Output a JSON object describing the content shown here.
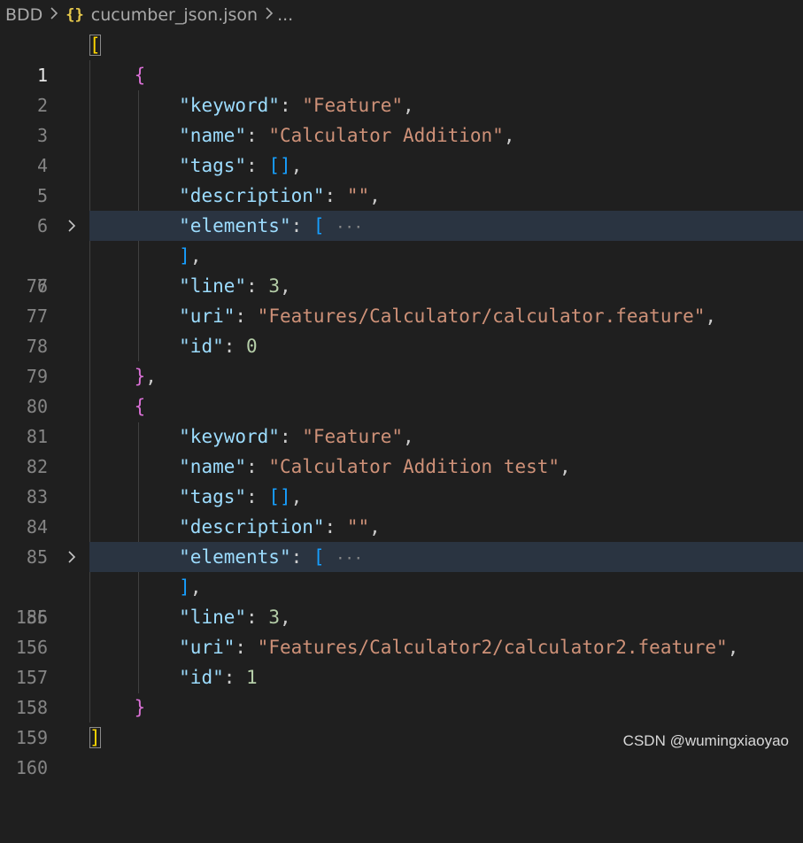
{
  "breadcrumb": {
    "folder": "BDD",
    "file_icon": "{}",
    "file": "cucumber_json.json",
    "more": "..."
  },
  "editor": {
    "lines": [
      {
        "num": "1"
      },
      {
        "num": "2"
      },
      {
        "num": "3",
        "key": "\"keyword\"",
        "value": "\"Feature\""
      },
      {
        "num": "4",
        "key": "\"name\"",
        "value": "\"Calculator Addition\""
      },
      {
        "num": "5",
        "key": "\"tags\""
      },
      {
        "num": "6",
        "key": "\"description\"",
        "value": "\"\""
      },
      {
        "num": "7",
        "key": "\"elements\"",
        "folded": "···"
      },
      {
        "num": "76"
      },
      {
        "num": "77",
        "key": "\"line\"",
        "value": "3"
      },
      {
        "num": "78",
        "key": "\"uri\"",
        "value": "\"Features/Calculator/calculator.feature\""
      },
      {
        "num": "79",
        "key": "\"id\"",
        "value": "0"
      },
      {
        "num": "80"
      },
      {
        "num": "81"
      },
      {
        "num": "82",
        "key": "\"keyword\"",
        "value": "\"Feature\""
      },
      {
        "num": "83",
        "key": "\"name\"",
        "value": "\"Calculator Addition test\""
      },
      {
        "num": "84",
        "key": "\"tags\""
      },
      {
        "num": "85",
        "key": "\"description\"",
        "value": "\"\""
      },
      {
        "num": "86",
        "key": "\"elements\"",
        "folded": "···"
      },
      {
        "num": "155"
      },
      {
        "num": "156",
        "key": "\"line\"",
        "value": "3"
      },
      {
        "num": "157",
        "key": "\"uri\"",
        "value": "\"Features/Calculator2/calculator2.feature\""
      },
      {
        "num": "158",
        "key": "\"id\"",
        "value": "1"
      },
      {
        "num": "159"
      },
      {
        "num": "160"
      }
    ]
  },
  "watermark": "CSDN @wumingxiaoyao",
  "colors": {
    "background": "#1f1f1f",
    "key": "#9cdcfe",
    "string": "#ce9178",
    "number": "#b5cea8",
    "bracket_level1": "#ffd700",
    "bracket_level2": "#da70d6",
    "bracket_level3": "#179fff",
    "folded_line_highlight": "#2a3441"
  },
  "icons": {
    "breadcrumb_separator": "chevron-right-icon",
    "fold": "chevron-right-icon"
  }
}
